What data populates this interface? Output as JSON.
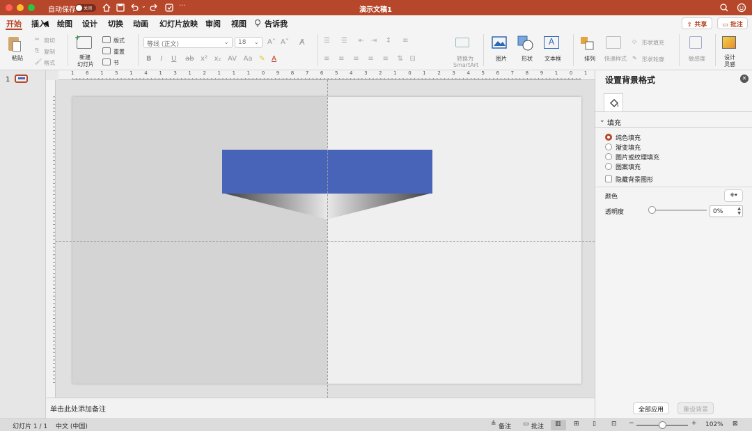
{
  "window": {
    "title": "演示文稿1",
    "autosave_label": "自动保存",
    "autosave_state": "关闭"
  },
  "menu": {
    "tabs": [
      "开始",
      "插入",
      "绘图",
      "设计",
      "切换",
      "动画",
      "幻灯片放映",
      "审阅",
      "视图"
    ],
    "tell_me": "告诉我",
    "share": "共享",
    "comment": "批注"
  },
  "ribbon": {
    "paste": "粘贴",
    "cut": "剪切",
    "copy": "复制",
    "format": "格式",
    "new_slide_1": "新建",
    "new_slide_2": "幻灯片",
    "layout": "版式",
    "reset": "重置",
    "section": "节",
    "font_name": "等线 (正文)",
    "font_size": "18",
    "convert_1": "转换为",
    "convert_2": "SmartArt",
    "picture": "图片",
    "shape": "形状",
    "textbox": "文本框",
    "arrange": "排列",
    "quick_style": "快速样式",
    "shape_fill": "形状填充",
    "shape_outline": "形状轮廓",
    "sensitivity": "敏感度",
    "designer_1": "设计",
    "designer_2": "灵感"
  },
  "thumbs": {
    "slide_number": "1"
  },
  "notes": {
    "placeholder": "单击此处添加备注"
  },
  "pane": {
    "title": "设置背景格式",
    "section": "填充",
    "options": [
      "纯色填充",
      "渐变填充",
      "图片或纹理填充",
      "图案填充"
    ],
    "hide_bg": "隐藏背景图形",
    "color_label": "颜色",
    "transparency_label": "透明度",
    "transparency_value": "0%",
    "apply_all": "全部应用",
    "reset_bg": "重设背景"
  },
  "status": {
    "slide_info": "幻灯片 1 / 1",
    "language": "中文 (中国)",
    "notes": "备注",
    "comments": "批注",
    "zoom": "102%"
  },
  "colors": {
    "accent": "#b7472a",
    "shape_blue": "#4864b8"
  }
}
